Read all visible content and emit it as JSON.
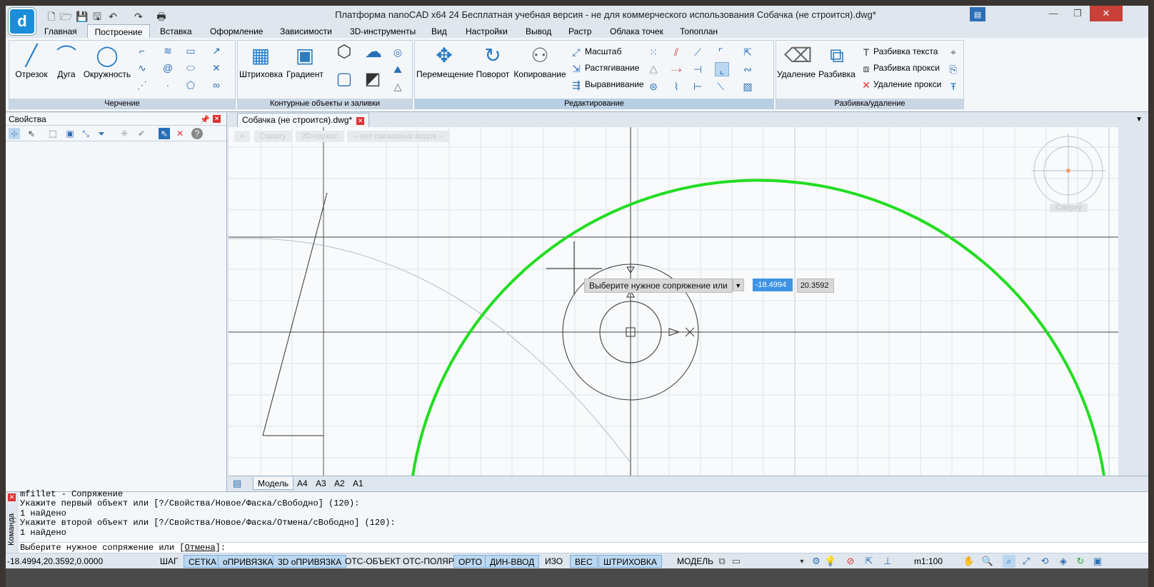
{
  "window": {
    "title": "Платформа nanoCAD x64 24  Бесплатная учебная версия - не для коммерческого использования Собачка (не строится).dwg*"
  },
  "menu": {
    "tabs": [
      "Главная",
      "Построение",
      "Вставка",
      "Оформление",
      "Зависимости",
      "3D-инструменты",
      "Вид",
      "Настройки",
      "Вывод",
      "Растр",
      "Облака точек",
      "Топоплан"
    ],
    "active": "Построение"
  },
  "ribbon": {
    "draw": {
      "title": "Черчение",
      "line": "Отрезок",
      "arc": "Дуга",
      "circle": "Окружность"
    },
    "hatch": {
      "title": "Контурные объекты и заливки",
      "hatch": "Штриховка",
      "gradient": "Градиент"
    },
    "edit": {
      "title": "Редактирование",
      "move": "Перемещение",
      "rotate": "Поворот",
      "copy": "Копирование",
      "scale": "Масштаб",
      "stretch": "Растягивание",
      "align": "Выравнивание"
    },
    "explode": {
      "title": "Разбивка/удаление",
      "erase": "Удаление",
      "explode": "Разбивка",
      "text_explode": "Разбивка текста",
      "proxy_explode": "Разбивка прокси",
      "proxy_delete": "Удаление прокси"
    }
  },
  "properties": {
    "title": "Свойства"
  },
  "document": {
    "tab": "Собачка (не строится).dwg*"
  },
  "viewport": {
    "buttons": [
      "+",
      "Сверху",
      "2D-каркас",
      "-- нет связанных видов --"
    ],
    "cube_label": "Сверху"
  },
  "tooltip": {
    "prompt": "Выберите нужное сопряжение или",
    "x": "-18.4994",
    "y": "20.3592"
  },
  "layouts": [
    "Модель",
    "A4",
    "A3",
    "A2",
    "A1"
  ],
  "command": {
    "side_label": "Команда",
    "lines": [
      "mfillet - Сопряжение",
      "Укажите первый объект или [?/Свойства/Новое/Фаска/сВободно] (120):",
      "1 найдено",
      "Укажите второй объект или [?/Свойства/Новое/Фаска/Отмена/сВободно] (120):",
      "1 найдено"
    ],
    "prompt_prefix": "Выберите нужное сопряжение или [",
    "prompt_option": "Отмена",
    "prompt_suffix": "]:"
  },
  "status": {
    "coords": "-18.4994,20.3592,0.0000",
    "toggles": [
      {
        "label": "ШАГ",
        "on": false
      },
      {
        "label": "СЕТКА",
        "on": true
      },
      {
        "label": "оПРИВЯЗКА",
        "on": true
      },
      {
        "label": "3D оПРИВЯЗКА",
        "on": true
      },
      {
        "label": "ОТС-ОБЪЕКТ",
        "on": false
      },
      {
        "label": "ОТС-ПОЛЯР",
        "on": false
      },
      {
        "label": "ОРТО",
        "on": true
      },
      {
        "label": "ДИН-ВВОД",
        "on": true
      },
      {
        "label": "ИЗО",
        "on": false
      },
      {
        "label": "ВЕС",
        "on": true
      },
      {
        "label": "ШТРИХОВКА",
        "on": true
      }
    ],
    "space": "МОДЕЛЬ",
    "scale": "m1:100"
  }
}
